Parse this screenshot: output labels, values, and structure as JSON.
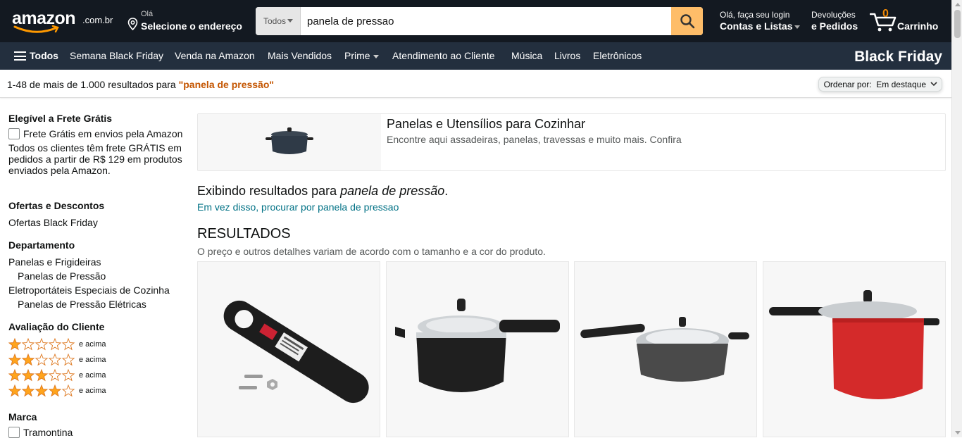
{
  "header": {
    "logo_word": "amazon",
    "logo_tld": ".com.br",
    "address_line1": "Olá",
    "address_line2": "Selecione o endereço",
    "search_category": "Todos",
    "search_value": "panela de pressao",
    "account_line1": "Olá, faça seu login",
    "account_line2": "Contas e Listas",
    "returns_line1": "Devoluções",
    "returns_line2": "e Pedidos",
    "cart_count": "0",
    "cart_label": "Carrinho"
  },
  "nav": {
    "all": "Todos",
    "items": [
      "Semana Black Friday",
      "Venda na Amazon",
      "Mais Vendidos",
      "Prime",
      "Atendimento ao Cliente",
      "Música",
      "Livros",
      "Eletrônicos"
    ],
    "promo": "Black Friday"
  },
  "results_bar": {
    "count_text": "1-48 de mais de 1.000 resultados para",
    "query": "\"panela de pressão\"",
    "sort_label": "Ordenar por:",
    "sort_value": "Em destaque"
  },
  "sidebar": {
    "free_shipping_title": "Elegível a Frete Grátis",
    "free_shipping_option": "Frete Grátis em envios pela Amazon",
    "free_shipping_note": "Todos os clientes têm frete GRÁTIS em pedidos a partir de R$ 129 em produtos enviados pela Amazon.",
    "deals_title": "Ofertas e Descontos",
    "deals_item": "Ofertas Black Friday",
    "dept_title": "Departamento",
    "dept_items": [
      "Panelas e Frigideiras",
      "Panelas de Pressão",
      "Eletroportáteis Especiais de Cozinha",
      "Panelas de Pressão Elétricas"
    ],
    "rating_title": "Avaliação do Cliente",
    "rating_suffix": "e acima",
    "rating_levels": [
      1,
      2,
      3,
      4
    ],
    "brand_title": "Marca",
    "brand_items": [
      "Tramontina"
    ]
  },
  "main": {
    "banner_title": "Panelas e Utensílios para Cozinhar",
    "banner_sub": "Encontre aqui assadeiras, panelas, travessas e muito mais. Confira",
    "showing_prefix": "Exibindo resultados para",
    "showing_query": "panela de pressão",
    "showing_suffix": ".",
    "instead_link": "Em vez disso, procurar por panela de pressao",
    "results_heading": "RESULTADOS",
    "results_sub": "O preço e outros detalhes variam de acordo com o tamanho e a cor do produto."
  },
  "colors": {
    "topbar": "#131921",
    "navbar": "#232f3e",
    "search_button": "#febd69",
    "query_highlight": "#c45500",
    "link": "#007185",
    "star": "#ffa41c",
    "product_red": "#d42a2a"
  },
  "products": [
    {
      "image": "black-pressure-cooker-handle"
    },
    {
      "image": "black-pressure-cooker"
    },
    {
      "image": "silver-dark-pressure-cooker"
    },
    {
      "image": "red-pressure-cooker"
    }
  ]
}
